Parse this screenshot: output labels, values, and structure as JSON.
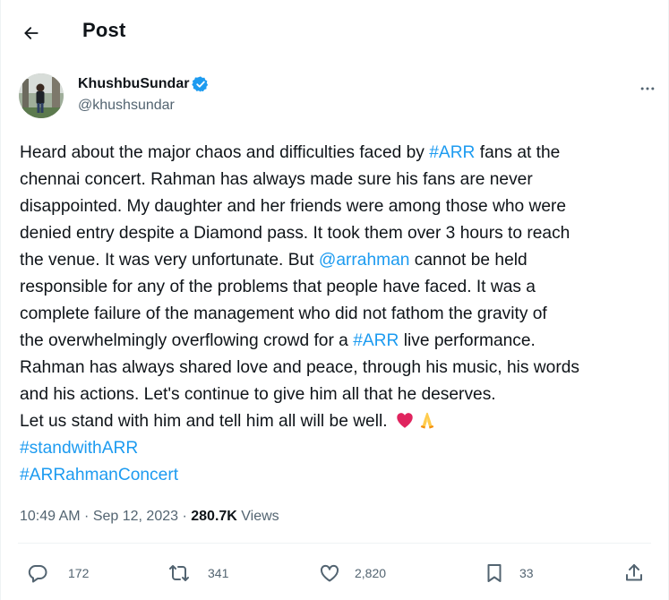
{
  "header": {
    "title": "Post"
  },
  "author": {
    "display_name": "KhushbuSundar",
    "handle": "@khushsundar"
  },
  "tweet": {
    "lines": [
      [
        {
          "t": "Heard about the major chaos and difficulties faced by "
        },
        {
          "t": "#ARR",
          "link": true
        },
        {
          "t": " fans at the"
        }
      ],
      [
        {
          "t": "chennai concert. Rahman has always made sure his fans are never"
        }
      ],
      [
        {
          "t": "disappointed. My daughter and her friends were among those who were"
        }
      ],
      [
        {
          "t": "denied entry despite a Diamond pass. It took them over 3 hours to reach"
        }
      ],
      [
        {
          "t": "the venue. It was very unfortunate. But "
        },
        {
          "t": "@arrahman",
          "link": true
        },
        {
          "t": " cannot be held"
        }
      ],
      [
        {
          "t": "responsible for any of the problems that people have faced. It was a"
        }
      ],
      [
        {
          "t": "complete failure of the management who did not fathom the gravity of"
        }
      ],
      [
        {
          "t": "the overwhelmingly overflowing crowd for a "
        },
        {
          "t": "#ARR",
          "link": true
        },
        {
          "t": " live performance."
        }
      ],
      [
        {
          "t": "Rahman has always shared love and peace, through his music, his words"
        }
      ],
      [
        {
          "t": "and his actions. Let's continue to give him all that he deserves."
        }
      ],
      [
        {
          "t": "Let us stand with him and tell him all will be well. "
        },
        {
          "emoji": "red-heart"
        },
        {
          "emoji": "folded-hands"
        }
      ],
      [
        {
          "t": "#standwithARR",
          "link": true
        }
      ],
      [
        {
          "t": "#ARRahmanConcert",
          "link": true
        }
      ]
    ]
  },
  "meta": {
    "time": "10:49 AM",
    "sep1": " · ",
    "date": "Sep 12, 2023",
    "sep2": " · ",
    "views_count": "280.7K",
    "views_label": " Views"
  },
  "actions": {
    "replies": "172",
    "reposts": "341",
    "likes": "2,820",
    "bookmarks": "33"
  },
  "icons": {
    "back": "arrow-left-icon",
    "verified": "verified-badge-icon",
    "more": "more-horizontal-icon",
    "reply": "reply-bubble-icon",
    "repost": "repost-icon",
    "like": "heart-icon",
    "bookmark": "bookmark-icon",
    "share": "share-upload-icon"
  },
  "colors": {
    "link": "#1d9bf0",
    "text": "#0f1419",
    "muted": "#536471",
    "border": "#eff3f4"
  }
}
